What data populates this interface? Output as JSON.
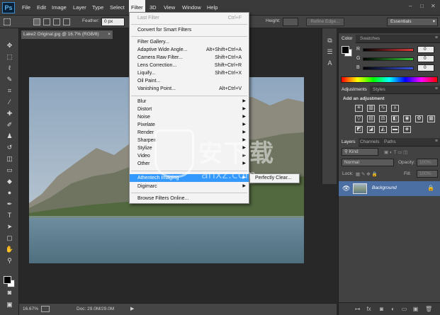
{
  "app": {
    "logo": "Ps"
  },
  "menubar": {
    "items": [
      "File",
      "Edit",
      "Image",
      "Layer",
      "Type",
      "Select",
      "Filter",
      "3D",
      "View",
      "Window",
      "Help"
    ],
    "active": "Filter",
    "window_buttons": [
      "–",
      "□",
      "✕"
    ]
  },
  "options_bar": {
    "feather_label": "Feather:",
    "feather_value": "0 px",
    "height_label": "Height:",
    "refine_edge_label": "Refine Edge...",
    "workspace": "Essentials"
  },
  "document": {
    "tab_title": "Lake2 Original.jpg @ 16.7% (RGB/8)",
    "tab_close": "×",
    "zoom": "16.67%",
    "doc_size": "Doc: 29.0M/29.0M",
    "status_arrow": "▶"
  },
  "filter_menu": {
    "items": [
      {
        "label": "Last Filter",
        "shortcut": "Ctrl+F",
        "disabled": true
      },
      {
        "separator": true
      },
      {
        "label": "Convert for Smart Filters"
      },
      {
        "separator": true
      },
      {
        "label": "Filter Gallery..."
      },
      {
        "label": "Adaptive Wide Angle...",
        "shortcut": "Alt+Shift+Ctrl+A"
      },
      {
        "label": "Camera Raw Filter...",
        "shortcut": "Shift+Ctrl+A"
      },
      {
        "label": "Lens Correction...",
        "shortcut": "Shift+Ctrl+R"
      },
      {
        "label": "Liquify...",
        "shortcut": "Shift+Ctrl+X"
      },
      {
        "label": "Oil Paint..."
      },
      {
        "label": "Vanishing Point...",
        "shortcut": "Alt+Ctrl+V"
      },
      {
        "separator": true
      },
      {
        "label": "Blur",
        "submenu": true
      },
      {
        "label": "Distort",
        "submenu": true
      },
      {
        "label": "Noise",
        "submenu": true
      },
      {
        "label": "Pixelate",
        "submenu": true
      },
      {
        "label": "Render",
        "submenu": true
      },
      {
        "label": "Sharpen",
        "submenu": true
      },
      {
        "label": "Stylize",
        "submenu": true
      },
      {
        "label": "Video",
        "submenu": true
      },
      {
        "label": "Other",
        "submenu": true
      },
      {
        "separator": true
      },
      {
        "label": "Athentech Imaging",
        "submenu": true,
        "highlighted": true
      },
      {
        "label": "Digimarc",
        "submenu": true
      },
      {
        "separator": true
      },
      {
        "label": "Browse Filters Online..."
      }
    ],
    "submenu_item": "Perfectly Clear..."
  },
  "color_panel": {
    "tabs": [
      "Color",
      "Swatches"
    ],
    "sliders": [
      {
        "label": "R",
        "value": "0",
        "color": "#e23a3a"
      },
      {
        "label": "G",
        "value": "0",
        "color": "#36c93a"
      },
      {
        "label": "B",
        "value": "0",
        "color": "#3a55e2"
      }
    ]
  },
  "adjustments_panel": {
    "tabs": [
      "Adjustments",
      "Styles"
    ],
    "heading": "Add an adjustment",
    "row1_icons": [
      "brightness-contrast-icon",
      "levels-icon",
      "curves-icon",
      "exposure-icon",
      "spacer",
      "spacer"
    ],
    "row2_icons": [
      "vibrance-icon",
      "hue-saturation-icon",
      "color-balance-icon",
      "black-white-icon",
      "photo-filter-icon",
      "channel-mixer-icon",
      "color-lookup-icon"
    ],
    "row3_icons": [
      "invert-icon",
      "posterize-icon",
      "threshold-icon",
      "gradient-map-icon",
      "selective-color-icon"
    ]
  },
  "layers_panel": {
    "tabs": [
      "Layers",
      "Channels",
      "Paths"
    ],
    "kind_label": "Kind",
    "blend_mode": "Normal",
    "opacity_label": "Opacity:",
    "opacity_value": "100%",
    "lock_label": "Lock:",
    "fill_label": "Fill:",
    "fill_value": "100%",
    "layer_name": "Background",
    "footer_icons": [
      "link-icon",
      "fx-icon",
      "mask-icon",
      "adjustment-layer-icon",
      "group-icon",
      "new-layer-icon",
      "trash-icon"
    ]
  },
  "watermark": {
    "cn": "安下载",
    "en": "anxz.com"
  },
  "colors": {
    "menu_highlight": "#3399ff",
    "layer_selected": "#4c6fa3",
    "ui_dark": "#282828"
  }
}
